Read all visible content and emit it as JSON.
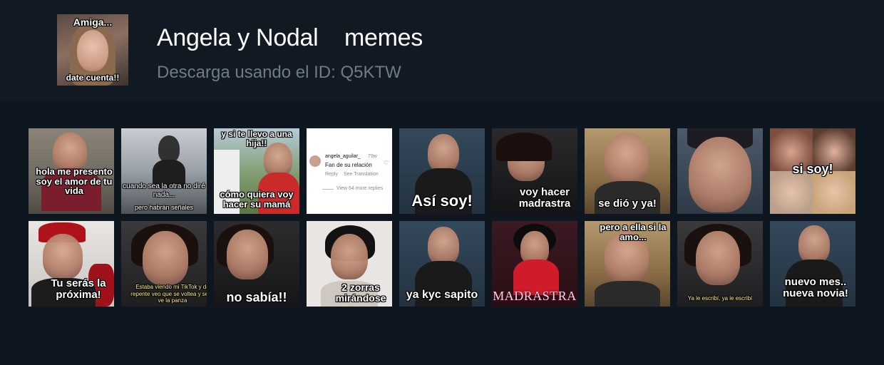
{
  "header": {
    "pack_thumb": {
      "caption_top": "Amiga...",
      "caption_bottom": "date cuenta!!"
    },
    "title": "Angela y Nodal    memes",
    "subtitle": "Descarga usando el ID: Q5KTW"
  },
  "comment_tile": {
    "username": "angela_aguilar_",
    "time": "79w",
    "text": "Fan de su relación",
    "reply": "Reply",
    "see_translation": "See Translation",
    "more_replies": "View 64 more replies"
  },
  "stickers_row1": [
    {
      "caption": "hola me presento soy el amor de tu vida"
    },
    {
      "caption": "cuando sea la otra no diré nada...",
      "caption2": "pero habrán señales"
    },
    {
      "caption": "y si te llevo a una hija!!",
      "caption2": "cómo quiera voy hacer su mamá"
    },
    {
      "caption": ""
    },
    {
      "caption": "Así soy!"
    },
    {
      "caption": "voy hacer madrastra"
    },
    {
      "caption": "se dió y ya!"
    },
    {
      "caption": ""
    },
    {
      "caption": "si soy!"
    }
  ],
  "stickers_row2": [
    {
      "caption": "Tu serás la próxima!"
    },
    {
      "caption": "Estaba viendo mi TikTok y de repente veo que se voltea y se le ve la panza"
    },
    {
      "caption": "no sabía!!"
    },
    {
      "caption": "2 zorras mirándose"
    },
    {
      "caption": "ya kyc sapito"
    },
    {
      "caption": "MADRASTRA"
    },
    {
      "caption": "pero a ella si la amo..."
    },
    {
      "caption": "Ya le escribí, ya le escribí"
    },
    {
      "caption": "nuevo mes.. nueva novia!"
    }
  ],
  "colors": {
    "page_bg": "#0e1620",
    "header_bg": "#111a23",
    "title": "#ffffff",
    "subtitle": "#6f7b86"
  }
}
